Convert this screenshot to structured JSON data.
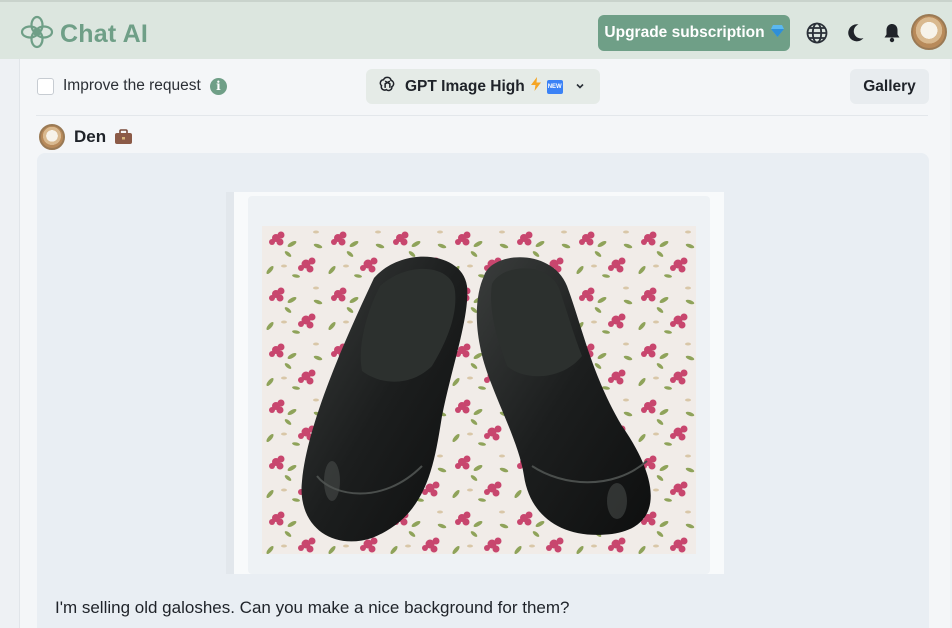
{
  "header": {
    "brand_name": "Chat AI",
    "upgrade_label": "Upgrade subscription",
    "icons": [
      "logo-knot-icon",
      "gem-icon",
      "globe-icon",
      "moon-icon",
      "bell-icon"
    ],
    "brand_color": "#6f9f87"
  },
  "toolbar": {
    "improve_label": "Improve the request",
    "improve_checked": false,
    "model_name": "GPT Image High",
    "new_badge": "NEW",
    "gallery_label": "Gallery"
  },
  "message": {
    "user_name": "Den",
    "text": "I'm selling old galoshes. Can you make a nice background for them?",
    "image_subject": "photo-galoshes"
  }
}
